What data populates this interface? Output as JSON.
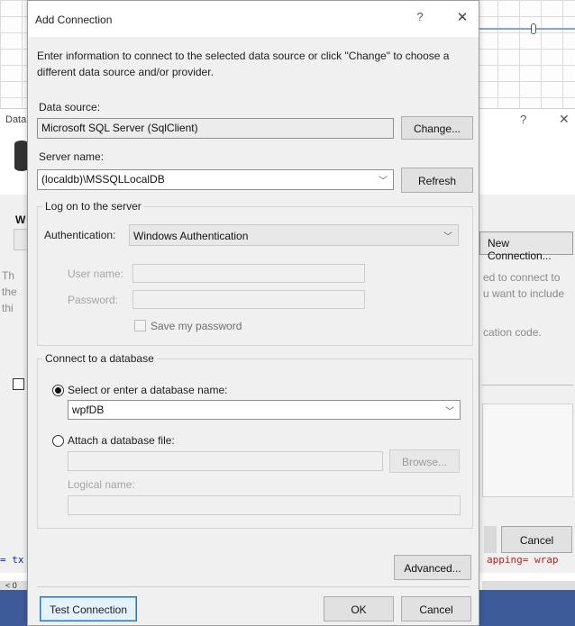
{
  "background": {
    "window_title": "Data",
    "help_glyph": "?",
    "close_glyph": "✕",
    "heading": "W",
    "new_connection_label": "New Connection...",
    "left_text_lines": [
      "Th",
      "the",
      "thi"
    ],
    "right_text_lines": [
      "ed to connect to",
      "u want to include"
    ],
    "right_text_extra": "cation code.",
    "cancel_label": "Cancel",
    "code_left": "= tx",
    "code_right": "apping= wrap",
    "scroll_left_label": "< 0"
  },
  "dialog": {
    "title": "Add Connection",
    "help_glyph": "?",
    "close_glyph": "✕",
    "intro_text": "Enter information to connect to the selected data source or click \"Change\" to choose a different data source and/or provider.",
    "data_source": {
      "label": "Data source:",
      "value": "Microsoft SQL Server (SqlClient)",
      "change_button": "Change..."
    },
    "server": {
      "label": "Server name:",
      "value": "(localdb)\\MSSQLLocalDB",
      "refresh_button": "Refresh"
    },
    "logon": {
      "group_title": "Log on to the server",
      "auth_label": "Authentication:",
      "auth_value": "Windows Authentication",
      "username_label": "User name:",
      "username_value": "",
      "password_label": "Password:",
      "password_value": "",
      "save_password_label": "Save my password",
      "save_password_checked": false
    },
    "database": {
      "group_title": "Connect to a database",
      "select_option_label": "Select or enter a database name:",
      "selected_option": "select",
      "db_name_value": "wpfDB",
      "attach_option_label": "Attach a database file:",
      "file_value": "",
      "browse_button": "Browse...",
      "logical_name_label": "Logical name:",
      "logical_name_value": ""
    },
    "advanced_button": "Advanced...",
    "footer": {
      "test_button": "Test Connection",
      "ok_button": "OK",
      "cancel_button": "Cancel"
    },
    "combo_arrow_glyph": "﹀"
  }
}
